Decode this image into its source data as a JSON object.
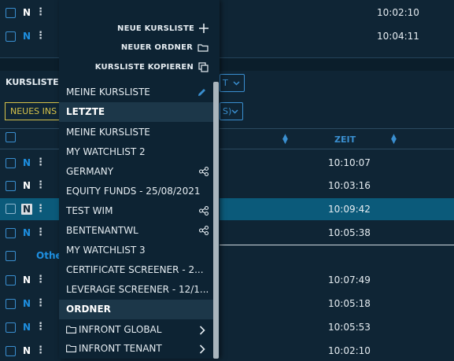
{
  "top_rows": [
    {
      "flag": "N",
      "time": "10:02:10"
    },
    {
      "flag": "N",
      "time": "10:04:11"
    }
  ],
  "panel": {
    "title": "KURSLISTE",
    "new_button_label": "NEUES INS",
    "dropdown_1_fragment": "T",
    "dropdown_2_fragment": "S)",
    "zeit_header": "ZEIT",
    "other_label": "Othe"
  },
  "rows": [
    {
      "flag": "N",
      "flag_style": "blue",
      "time": "10:10:07"
    },
    {
      "flag": "N",
      "flag_style": "white",
      "time": "10:03:16"
    },
    {
      "flag": "N",
      "flag_style": "boxed",
      "time": "10:09:42"
    },
    {
      "flag": "N",
      "flag_style": "blue",
      "time": "10:05:38"
    }
  ],
  "other_rows": [
    {
      "flag": "N",
      "flag_style": "white",
      "time": "10:07:49"
    },
    {
      "flag": "N",
      "flag_style": "blue",
      "time": "10:05:18"
    },
    {
      "flag": "N",
      "flag_style": "blue",
      "time": "10:05:53"
    },
    {
      "flag": "N",
      "flag_style": "white",
      "time": "10:02:10"
    }
  ],
  "menu": {
    "actions": {
      "new_list": "NEUE KURSLISTE",
      "new_folder": "NEUER ORDNER",
      "copy_list": "KURSLISTE KOPIEREN"
    },
    "current": "MEINE KURSLISTE",
    "recent_header": "LETZTE",
    "recent": [
      {
        "label": "MEINE KURSLISTE",
        "shared": false
      },
      {
        "label": "MY WATCHLIST 2",
        "shared": false
      },
      {
        "label": "GERMANY",
        "shared": true
      },
      {
        "label": "EQUITY FUNDS - 25/08/2021",
        "shared": false
      },
      {
        "label": "TEST WIM",
        "shared": true
      },
      {
        "label": "BENTENANTWL",
        "shared": true
      },
      {
        "label": "MY WATCHLIST 3",
        "shared": false
      },
      {
        "label": "CERTIFICATE SCREENER - 2...",
        "shared": false
      },
      {
        "label": "LEVERAGE SCREENER - 12/1...",
        "shared": false
      }
    ],
    "folders_header": "ORDNER",
    "folders": [
      "INFRONT GLOBAL",
      "INFRONT TENANT"
    ]
  },
  "colors": {
    "background": "#0f2535",
    "menu_bg": "#0d2333",
    "accent_blue": "#3a8fd0",
    "highlight_row": "#0b5a7a",
    "yellow": "#d6c24a"
  }
}
